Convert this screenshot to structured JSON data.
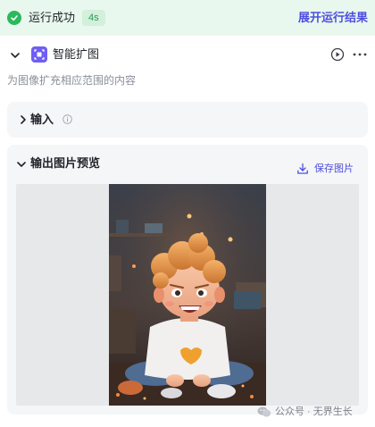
{
  "status": {
    "text": "运行成功",
    "duration": "4s",
    "expand_link": "展开运行结果",
    "color": "#2cb85c"
  },
  "node": {
    "title": "智能扩图",
    "description": "为图像扩充相应范围的内容",
    "icon": "image-expand-icon",
    "icon_color": "#6f5df5"
  },
  "input_section": {
    "label": "输入",
    "expanded": false
  },
  "output_section": {
    "title": "输出图片预览",
    "save_label": "保存图片",
    "expanded": true,
    "preview_alt": "3D cartoon girl with curly orange hair sitting on floor"
  },
  "watermark": {
    "text": "公众号 · 无界生长"
  },
  "colors": {
    "accent": "#4e4ee0",
    "success_bg": "#e9f8ee",
    "card_bg": "#f5f6f7"
  }
}
